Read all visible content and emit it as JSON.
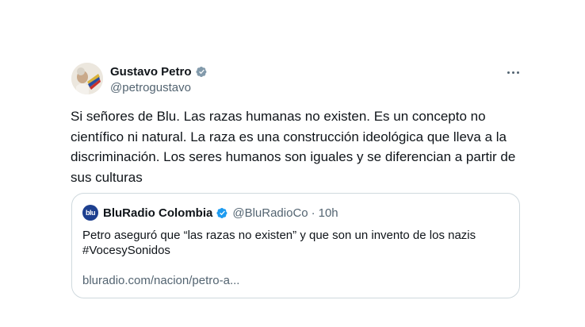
{
  "author": {
    "display_name": "Gustavo Petro",
    "handle": "@petrogustavo",
    "avatar_icon": "profile-photo",
    "verified_color": "#829aab"
  },
  "tweet": {
    "text": "Si señores de Blu. Las razas humanas no existen. Es un concepto no científico ni natural. La raza es una construcción ideológica que lleva a la discriminación. Los seres humanos son iguales y se diferencian a partir de sus culturas"
  },
  "quoted_tweet": {
    "avatar_text": "blu",
    "display_name": "BluRadio Colombia",
    "verified_color": "#1d9bf0",
    "handle": "@BluRadioCo",
    "separator": "·",
    "time": "10h",
    "text_line1": "Petro aseguró que “las razas no existen” y que son un invento de los nazis",
    "text_line2": "#VocesySonidos",
    "link": "bluradio.com/nacion/petro-a..."
  },
  "colors": {
    "text_primary": "#0f1419",
    "text_secondary": "#536471",
    "border": "#cfd9de"
  }
}
